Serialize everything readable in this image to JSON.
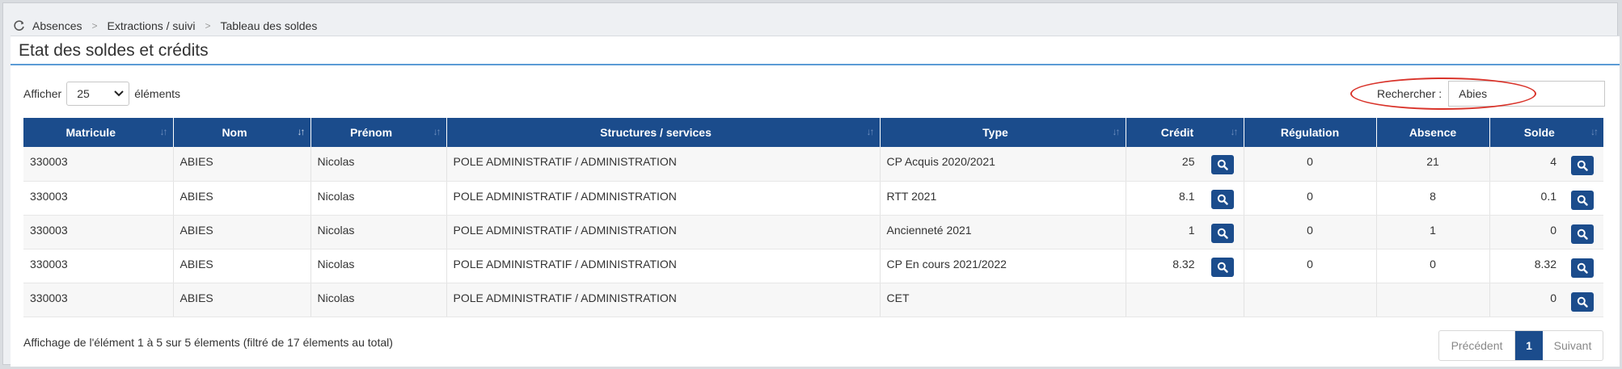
{
  "breadcrumb": [
    "Absences",
    "Extractions / suivi",
    "Tableau des soldes"
  ],
  "page_title": "Etat des soldes et crédits",
  "length_control": {
    "prefix": "Afficher",
    "value": "25",
    "suffix": "éléments"
  },
  "search": {
    "label": "Rechercher :",
    "value": "Abies"
  },
  "columns": [
    "Matricule",
    "Nom",
    "Prénom",
    "Structures / services",
    "Type",
    "Crédit",
    "Régulation",
    "Absence",
    "Solde"
  ],
  "rows": [
    {
      "matricule": "330003",
      "nom": "ABIES",
      "prenom": "Nicolas",
      "structure": "POLE ADMINISTRATIF / ADMINISTRATION",
      "type": "CP Acquis 2020/2021",
      "credit": "25",
      "regulation": "0",
      "absence": "21",
      "solde": "4"
    },
    {
      "matricule": "330003",
      "nom": "ABIES",
      "prenom": "Nicolas",
      "structure": "POLE ADMINISTRATIF / ADMINISTRATION",
      "type": "RTT 2021",
      "credit": "8.1",
      "regulation": "0",
      "absence": "8",
      "solde": "0.1"
    },
    {
      "matricule": "330003",
      "nom": "ABIES",
      "prenom": "Nicolas",
      "structure": "POLE ADMINISTRATIF / ADMINISTRATION",
      "type": "Ancienneté 2021",
      "credit": "1",
      "regulation": "0",
      "absence": "1",
      "solde": "0"
    },
    {
      "matricule": "330003",
      "nom": "ABIES",
      "prenom": "Nicolas",
      "structure": "POLE ADMINISTRATIF / ADMINISTRATION",
      "type": "CP En cours 2021/2022",
      "credit": "8.32",
      "regulation": "0",
      "absence": "0",
      "solde": "8.32"
    },
    {
      "matricule": "330003",
      "nom": "ABIES",
      "prenom": "Nicolas",
      "structure": "POLE ADMINISTRATIF / ADMINISTRATION",
      "type": "CET",
      "credit": "",
      "regulation": "",
      "absence": "",
      "solde": "0"
    }
  ],
  "info_text": "Affichage de l'élément 1 à  5 sur 5 élements (filtré de 17 élements au total)",
  "pager": {
    "prev": "Précédent",
    "current": "1",
    "next": "Suivant"
  },
  "colors": {
    "header": "#1b4c8c",
    "accent_rule": "#5b9bd5",
    "highlight": "#d9342b"
  },
  "icons": [
    "refresh-icon",
    "sort-icon",
    "search-magnifier-icon",
    "chevron-down-icon"
  ]
}
